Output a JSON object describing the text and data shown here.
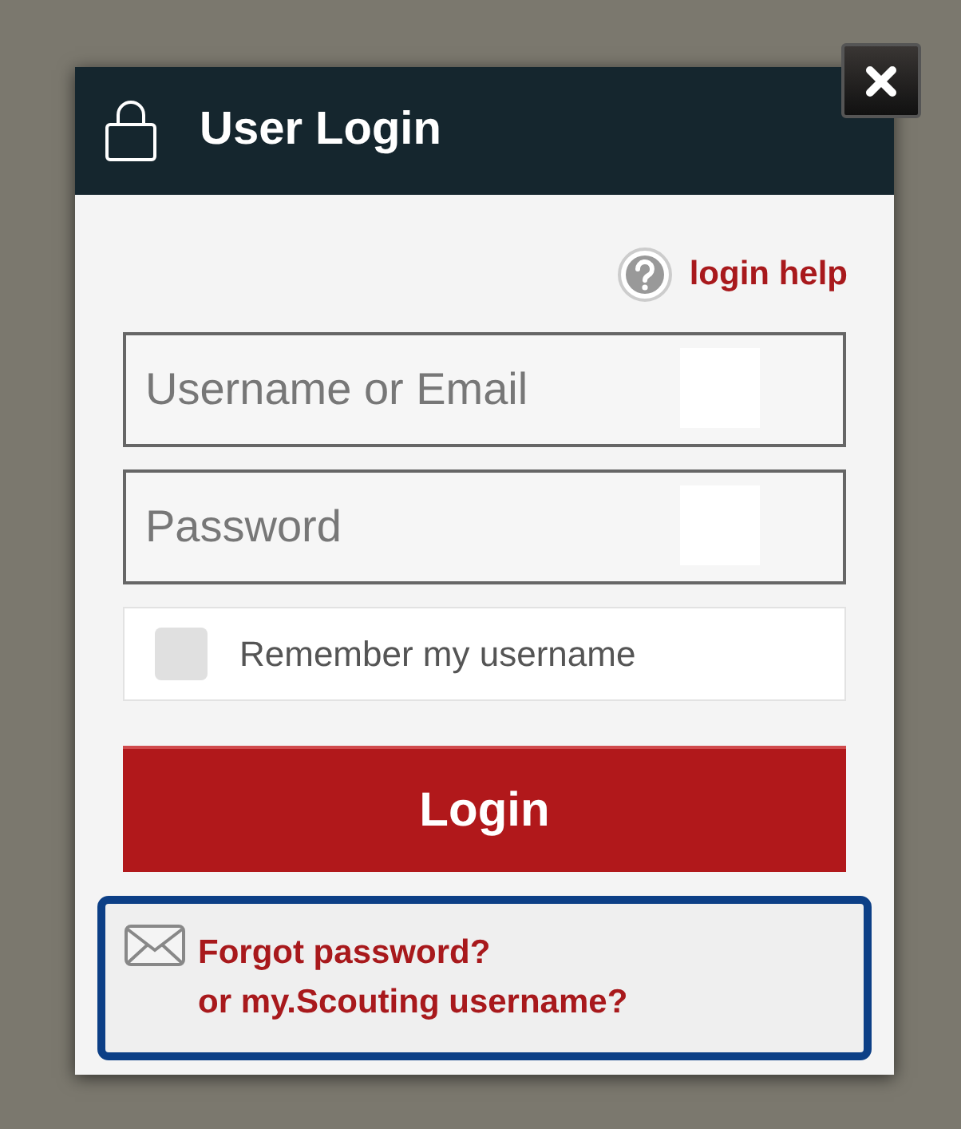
{
  "dialog": {
    "title": "User Login"
  },
  "help_link": {
    "label": "login help"
  },
  "fields": [
    {
      "placeholder": "Username or Email"
    },
    {
      "placeholder": "Password"
    }
  ],
  "remember": {
    "label": "Remember my username",
    "checked": false
  },
  "login_button": {
    "label": "Login"
  },
  "forgot_links": [
    "Forgot password?",
    "or my.Scouting username?"
  ]
}
